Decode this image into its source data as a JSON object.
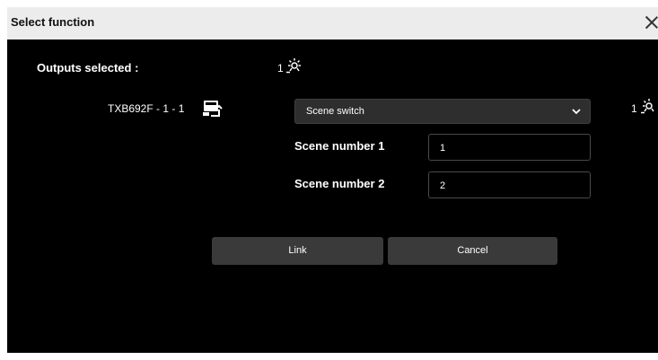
{
  "dialog": {
    "title": "Select function"
  },
  "outputs": {
    "label": "Outputs selected :",
    "count": "1"
  },
  "device": {
    "name": "TXB692F - 1 - 1",
    "right_count": "1"
  },
  "function_select": {
    "value": "Scene switch"
  },
  "fields": [
    {
      "label": "Scene number 1",
      "value": "1"
    },
    {
      "label": "Scene number 2",
      "value": "2"
    }
  ],
  "buttons": {
    "link": "Link",
    "cancel": "Cancel"
  },
  "colors": {
    "background": "#000000",
    "titlebar": "#ececec",
    "button": "#3a3a3a"
  },
  "icons": [
    "close-icon",
    "light-icon",
    "device-icon",
    "chevron-down-icon"
  ]
}
